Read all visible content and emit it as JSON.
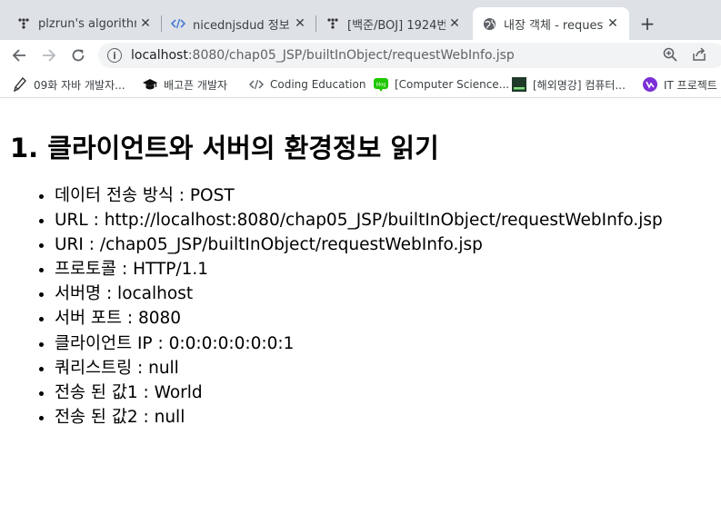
{
  "tabs": [
    {
      "label": "plzrun's algorithm",
      "icon": "tistory-icon",
      "active": false
    },
    {
      "label": "nicednjsdud 정보",
      "icon": "code-brackets-icon",
      "active": false
    },
    {
      "label": "[백준/BOJ] 1924번",
      "icon": "tistory-icon",
      "active": false
    },
    {
      "label": "내장 객체 - request",
      "icon": "globe-icon",
      "active": true
    }
  ],
  "address_bar": {
    "host": "localhost",
    "rest": ":8080/chap05_JSP/builtInObject/requestWebInfo.jsp"
  },
  "bookmarks": [
    {
      "label": "09화 자바 개발자...",
      "icon": "pen-nib-icon"
    },
    {
      "label": "배고픈 개발자",
      "icon": "graduation-cap-icon"
    },
    {
      "label": "Coding Education",
      "icon": "code-brackets-icon"
    },
    {
      "label": "[Computer Science...",
      "icon": "blog-icon"
    },
    {
      "label": "[해외명강] 컴퓨터...",
      "icon": "terminal-icon"
    },
    {
      "label": "IT 프로젝트",
      "icon": "purple-logo-icon"
    }
  ],
  "page": {
    "heading": "1. 클라이언트와 서버의 환경정보 읽기",
    "items": [
      "데이터 전송 방식 : POST",
      "URL : http://localhost:8080/chap05_JSP/builtInObject/requestWebInfo.jsp",
      "URI : /chap05_JSP/builtInObject/requestWebInfo.jsp",
      "프로토콜 : HTTP/1.1",
      "서버명 : localhost",
      "서버 포트 : 8080",
      "클라이언트 IP : 0:0:0:0:0:0:0:1",
      "쿼리스트링 : null",
      "전송 된 값1 : World",
      "전송 된 값2 : null"
    ]
  }
}
